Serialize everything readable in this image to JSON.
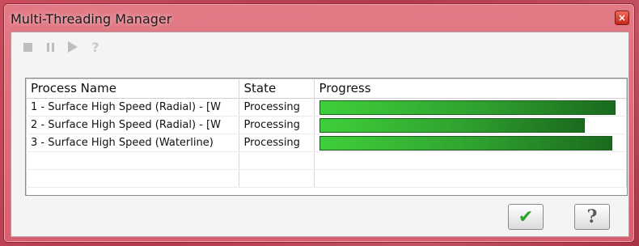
{
  "window": {
    "title": "Multi-Threading Manager",
    "close_glyph": "×"
  },
  "toolbar": {
    "stop_icon": "stop-icon",
    "pause_icon": "pause-icon",
    "play_icon": "play-icon",
    "help_label": "?"
  },
  "table": {
    "headers": [
      "Process Name",
      "State",
      "Progress"
    ],
    "rows": [
      {
        "name": "1 - Surface High Speed (Radial) - [W",
        "state": "Processing",
        "progress": 0.98
      },
      {
        "name": "2 - Surface High Speed (Radial) - [W",
        "state": "Processing",
        "progress": 0.88
      },
      {
        "name": "3 - Surface High Speed (Waterline)",
        "state": "Processing",
        "progress": 0.97
      }
    ],
    "empty_rows": 2
  },
  "buttons": {
    "ok_glyph": "✔",
    "help_glyph": "?"
  },
  "colors": {
    "accent_window": "#d75f6f",
    "progress_green": "#2fa02e"
  }
}
